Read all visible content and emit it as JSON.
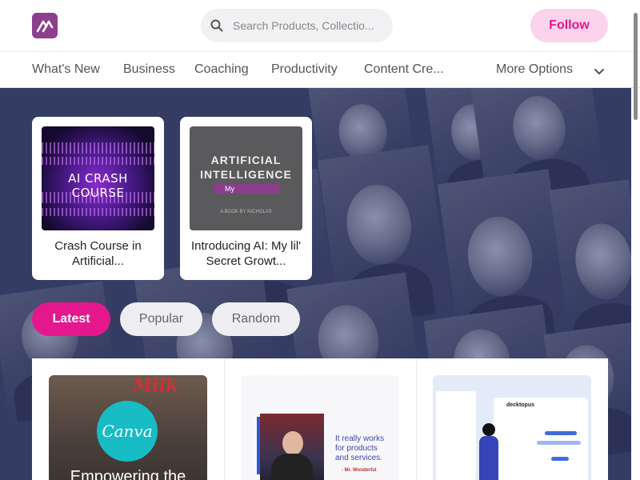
{
  "header": {
    "search_placeholder": "Search Products, Collectio...",
    "follow_label": "Follow"
  },
  "nav": {
    "items": [
      "What's New",
      "Business",
      "Coaching",
      "Productivity",
      "Content Cre..."
    ],
    "more_label": "More Options"
  },
  "featured": [
    {
      "title": "Crash Course in Artificial...",
      "thumb_text": "AI CRASH COURSE"
    },
    {
      "title": "Introducing AI: My lil' Secret Growt...",
      "thumb_lines": [
        "ARTIFICIAL",
        "INTELLIGENCE"
      ],
      "thumb_bar": "My",
      "thumb_small": "A BOOK BY NICHOLAS"
    }
  ],
  "filters": {
    "latest": "Latest",
    "popular": "Popular",
    "random": "Random",
    "active": "Latest"
  },
  "products": [
    {
      "logo_text": "Canva",
      "overlay_text": "Empowering the",
      "corner_text": "Milk"
    },
    {
      "text": "It really works for products and services.",
      "by": "- Mr. Wonderful"
    },
    {
      "brand": "decktopus"
    }
  ],
  "colors": {
    "accent": "#e5178d",
    "follow_bg": "#fbd3ec",
    "hero_bg": "#394066",
    "logo_bg": "#8b3f8c"
  }
}
